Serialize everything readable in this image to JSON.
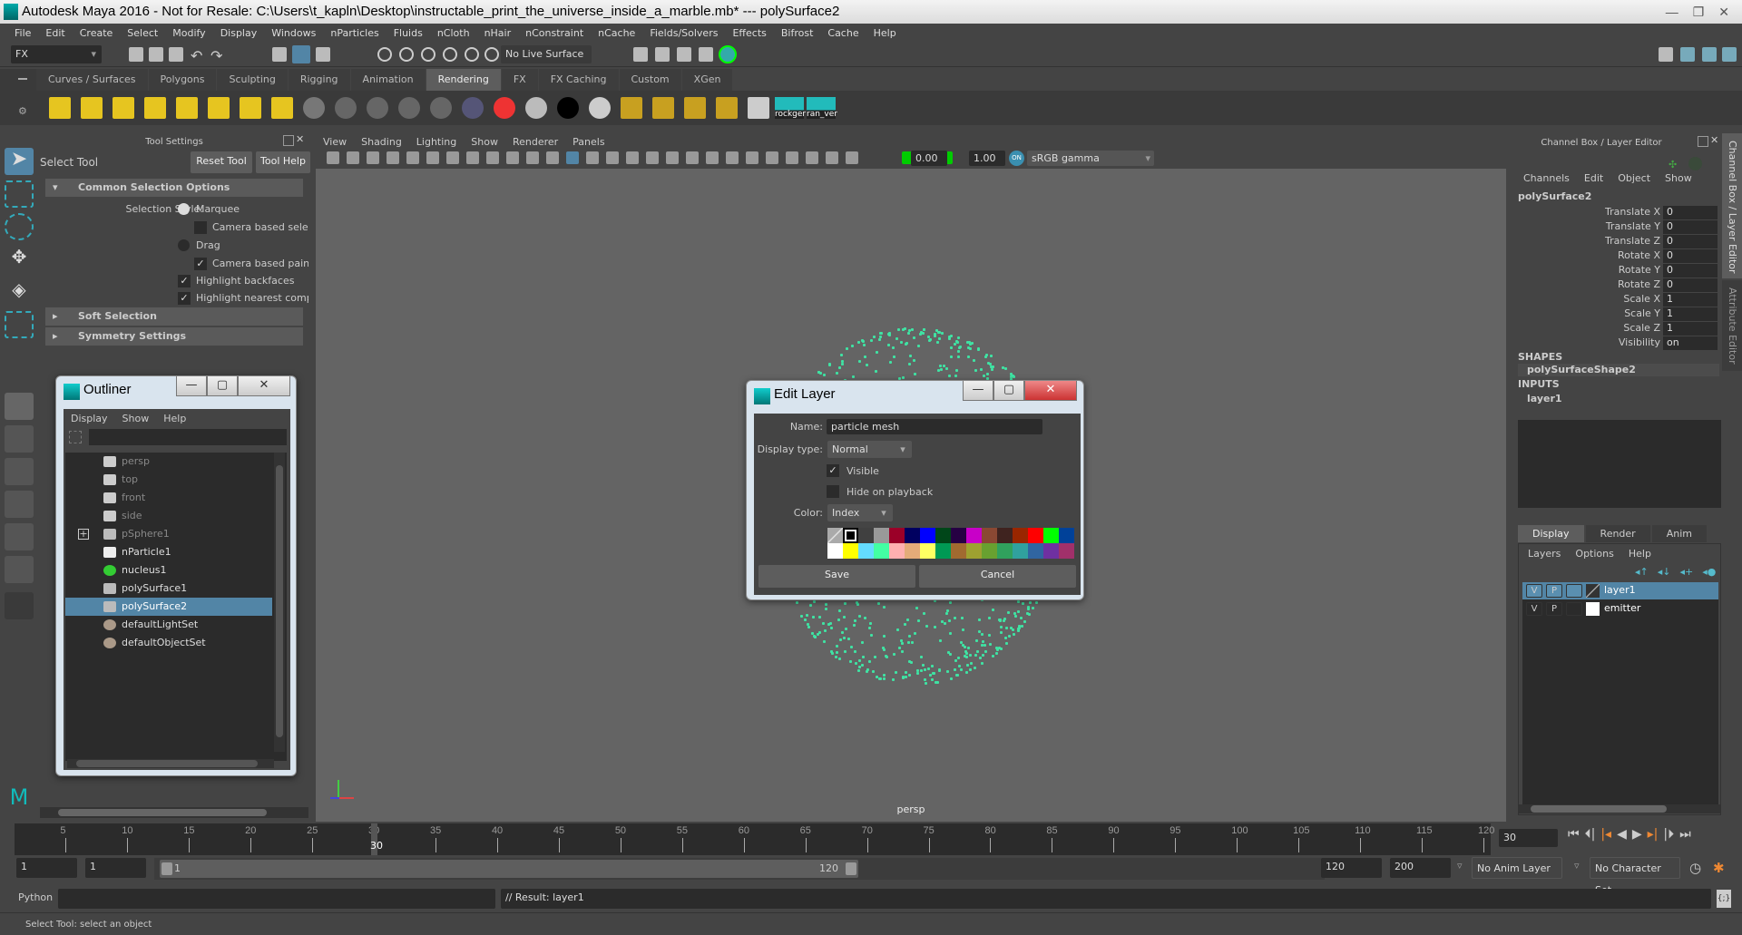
{
  "window": {
    "title": "Autodesk Maya 2016 - Not for Resale: C:\\Users\\t_kapln\\Desktop\\instructable_print_the_universe_inside_a_marble.mb*  ---  polySurface2",
    "min": "—",
    "max": "❐",
    "close": "✕"
  },
  "menubar": [
    "File",
    "Edit",
    "Create",
    "Select",
    "Modify",
    "Display",
    "Windows",
    "nParticles",
    "Fluids",
    "nCloth",
    "nHair",
    "nConstraint",
    "nCache",
    "Fields/Solvers",
    "Effects",
    "Bifrost",
    "Cache",
    "Help"
  ],
  "statusline": {
    "menuset": "FX",
    "live_surface": "No Live Surface"
  },
  "shelf": {
    "tabs": [
      "Curves / Surfaces",
      "Polygons",
      "Sculpting",
      "Rigging",
      "Animation",
      "Rendering",
      "FX",
      "FX Caching",
      "Custom",
      "XGen"
    ],
    "active": "Rendering",
    "custom_buttons": [
      "rockger",
      "ran_ver"
    ]
  },
  "tool_settings": {
    "panel_title": "Tool Settings",
    "tool_name": "Select Tool",
    "reset": "Reset Tool",
    "help": "Tool Help",
    "sections": [
      "Common Selection Options",
      "Soft Selection",
      "Symmetry Settings"
    ],
    "selection_style_label": "Selection Style:",
    "options": [
      {
        "label": "Marquee",
        "type": "radio",
        "checked": true
      },
      {
        "label": "Camera based selection",
        "type": "checkbox",
        "checked": false
      },
      {
        "label": "Drag",
        "type": "radio",
        "checked": false
      },
      {
        "label": "Camera based paint s",
        "type": "checkbox",
        "checked": true
      },
      {
        "label": "Highlight backfaces",
        "type": "checkbox",
        "checked": true
      },
      {
        "label": "Highlight nearest compo",
        "type": "checkbox",
        "checked": true
      }
    ]
  },
  "viewport": {
    "menus": [
      "View",
      "Shading",
      "Lighting",
      "Show",
      "Renderer",
      "Panels"
    ],
    "exposure": "0.00",
    "gamma": "1.00",
    "color_space": "sRGB gamma",
    "camera_label": "persp",
    "particle_color": "#3fe3a3"
  },
  "outliner": {
    "title": "Outliner",
    "menus": [
      "Display",
      "Show",
      "Help"
    ],
    "items": [
      {
        "label": "persp",
        "icon": "camera-icon",
        "dim": true
      },
      {
        "label": "top",
        "icon": "camera-icon",
        "dim": true
      },
      {
        "label": "front",
        "icon": "camera-icon",
        "dim": true
      },
      {
        "label": "side",
        "icon": "camera-icon",
        "dim": true
      },
      {
        "label": "pSphere1",
        "icon": "mesh-icon",
        "dim": true,
        "expandable": true
      },
      {
        "label": "nParticle1",
        "icon": "nparticle-icon"
      },
      {
        "label": "nucleus1",
        "icon": "nucleus-icon"
      },
      {
        "label": "polySurface1",
        "icon": "mesh-icon"
      },
      {
        "label": "polySurface2",
        "icon": "mesh-icon",
        "selected": true
      },
      {
        "label": "defaultLightSet",
        "icon": "set-icon"
      },
      {
        "label": "defaultObjectSet",
        "icon": "set-icon"
      }
    ]
  },
  "edit_layer": {
    "title": "Edit Layer",
    "name_label": "Name:",
    "name_value": "particle mesh",
    "display_type_label": "Display type:",
    "display_type": "Normal",
    "visible_label": "Visible",
    "visible": true,
    "hide_label": "Hide on playback",
    "hide": false,
    "color_label": "Color:",
    "color_mode": "Index",
    "save": "Save",
    "cancel": "Cancel",
    "palette": [
      [
        "none",
        "#000000",
        "#404040",
        "#999999",
        "#9b0028",
        "#000060",
        "#0000ff",
        "#004619",
        "#260043",
        "#c800c8",
        "#8a4833",
        "#3f231f",
        "#992600",
        "#ff0000",
        "#00ff00",
        "#004199"
      ],
      [
        "#ffffff",
        "#ffff00",
        "#64dcff",
        "#43ffa3",
        "#ffb0b0",
        "#e4ac79",
        "#ffff63",
        "#009954",
        "#a16a30",
        "#9ea130",
        "#68a130",
        "#30a15d",
        "#30a19e",
        "#3065a1",
        "#6f30a1",
        "#a1306a"
      ]
    ]
  },
  "channel_box": {
    "panel_title": "Channel Box / Layer Editor",
    "menus": [
      "Channels",
      "Edit",
      "Object",
      "Show"
    ],
    "object": "polySurface2",
    "channels": [
      {
        "label": "Translate X",
        "value": "0"
      },
      {
        "label": "Translate Y",
        "value": "0"
      },
      {
        "label": "Translate Z",
        "value": "0"
      },
      {
        "label": "Rotate X",
        "value": "0"
      },
      {
        "label": "Rotate Y",
        "value": "0"
      },
      {
        "label": "Rotate Z",
        "value": "0"
      },
      {
        "label": "Scale X",
        "value": "1"
      },
      {
        "label": "Scale Y",
        "value": "1"
      },
      {
        "label": "Scale Z",
        "value": "1"
      },
      {
        "label": "Visibility",
        "value": "on"
      }
    ],
    "shapes_header": "SHAPES",
    "shape": "polySurfaceShape2",
    "inputs_header": "INPUTS",
    "input": "layer1",
    "layer_tabs": [
      "Display",
      "Render",
      "Anim"
    ],
    "layer_menus": [
      "Layers",
      "Options",
      "Help"
    ],
    "layers": [
      {
        "v": "V",
        "p": "P",
        "name": "layer1",
        "selected": true
      },
      {
        "v": "V",
        "p": "P",
        "name": "emitter",
        "selected": false
      }
    ],
    "side_tabs": [
      "Channel Box / Layer Editor",
      "Attribute Editor"
    ]
  },
  "timeline": {
    "start": 1,
    "end": 120,
    "current": 30,
    "ticks": [
      "5",
      "10",
      "15",
      "20",
      "25",
      "30",
      "35",
      "40",
      "45",
      "50",
      "55",
      "60",
      "65",
      "70",
      "75",
      "80",
      "85",
      "90",
      "95",
      "100",
      "105",
      "110",
      "115",
      "120"
    ],
    "current_field": "30"
  },
  "range": {
    "start": "1",
    "anim_start": "1",
    "range_start": "1",
    "range_end": "120",
    "end": "120",
    "anim_end": "200",
    "anim_layer": "No Anim Layer",
    "character_set": "No Character Set"
  },
  "command_line": {
    "language": "Python",
    "result": "// Result: layer1"
  },
  "help_line": "Select Tool: select an object"
}
